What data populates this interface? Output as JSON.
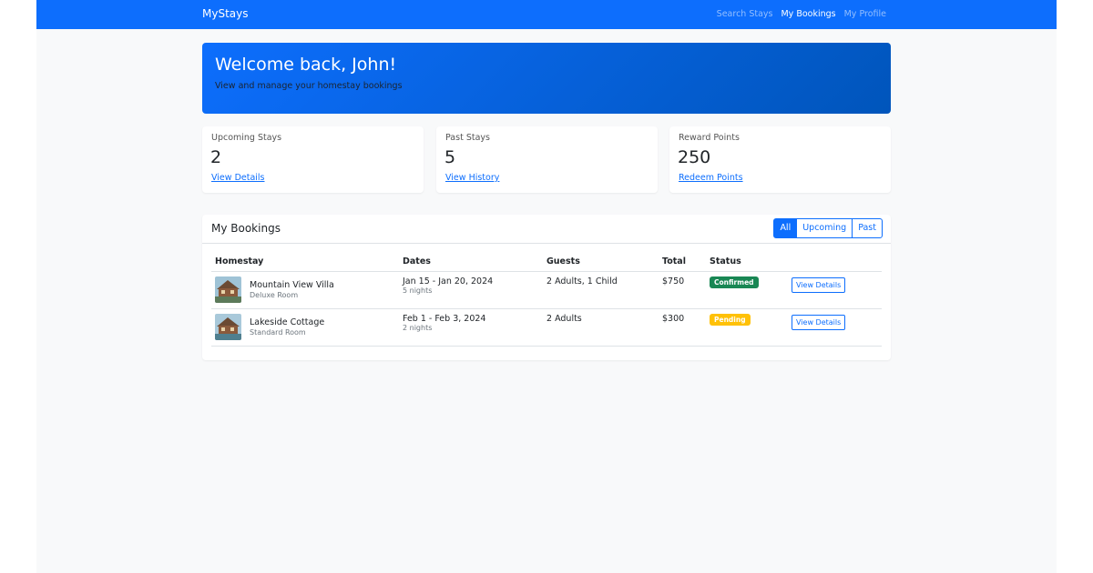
{
  "nav": {
    "brand": "MyStays",
    "links": [
      "Search Stays",
      "My Bookings",
      "My Profile"
    ]
  },
  "hero": {
    "title": "Welcome back, John!",
    "subtitle": "View and manage your homestay bookings"
  },
  "stats": [
    {
      "label": "Upcoming Stays",
      "value": "2",
      "link": "View Details"
    },
    {
      "label": "Past Stays",
      "value": "5",
      "link": "View History"
    },
    {
      "label": "Reward Points",
      "value": "250",
      "link": "Redeem Points"
    }
  ],
  "bookings": {
    "title": "My Bookings",
    "filters": [
      "All",
      "Upcoming",
      "Past"
    ],
    "active_filter": "All",
    "columns": [
      "Homestay",
      "Dates",
      "Guests",
      "Total",
      "Status",
      ""
    ],
    "rows": [
      {
        "name": "Mountain View Villa",
        "room": "Deluxe Room",
        "dates": "Jan 15 - Jan 20, 2024",
        "nights": "5 nights",
        "guests": "2 Adults, 1 Child",
        "total": "$750",
        "status": "Confirmed",
        "action": "View Details"
      },
      {
        "name": "Lakeside Cottage",
        "room": "Standard Room",
        "dates": "Feb 1 - Feb 3, 2024",
        "nights": "2 nights",
        "guests": "2 Adults",
        "total": "$300",
        "status": "Pending",
        "action": "View Details"
      }
    ]
  },
  "colors": {
    "primary": "#0d6efd",
    "success": "#198754",
    "warning": "#ffc107",
    "background": "#f8f9fa"
  }
}
